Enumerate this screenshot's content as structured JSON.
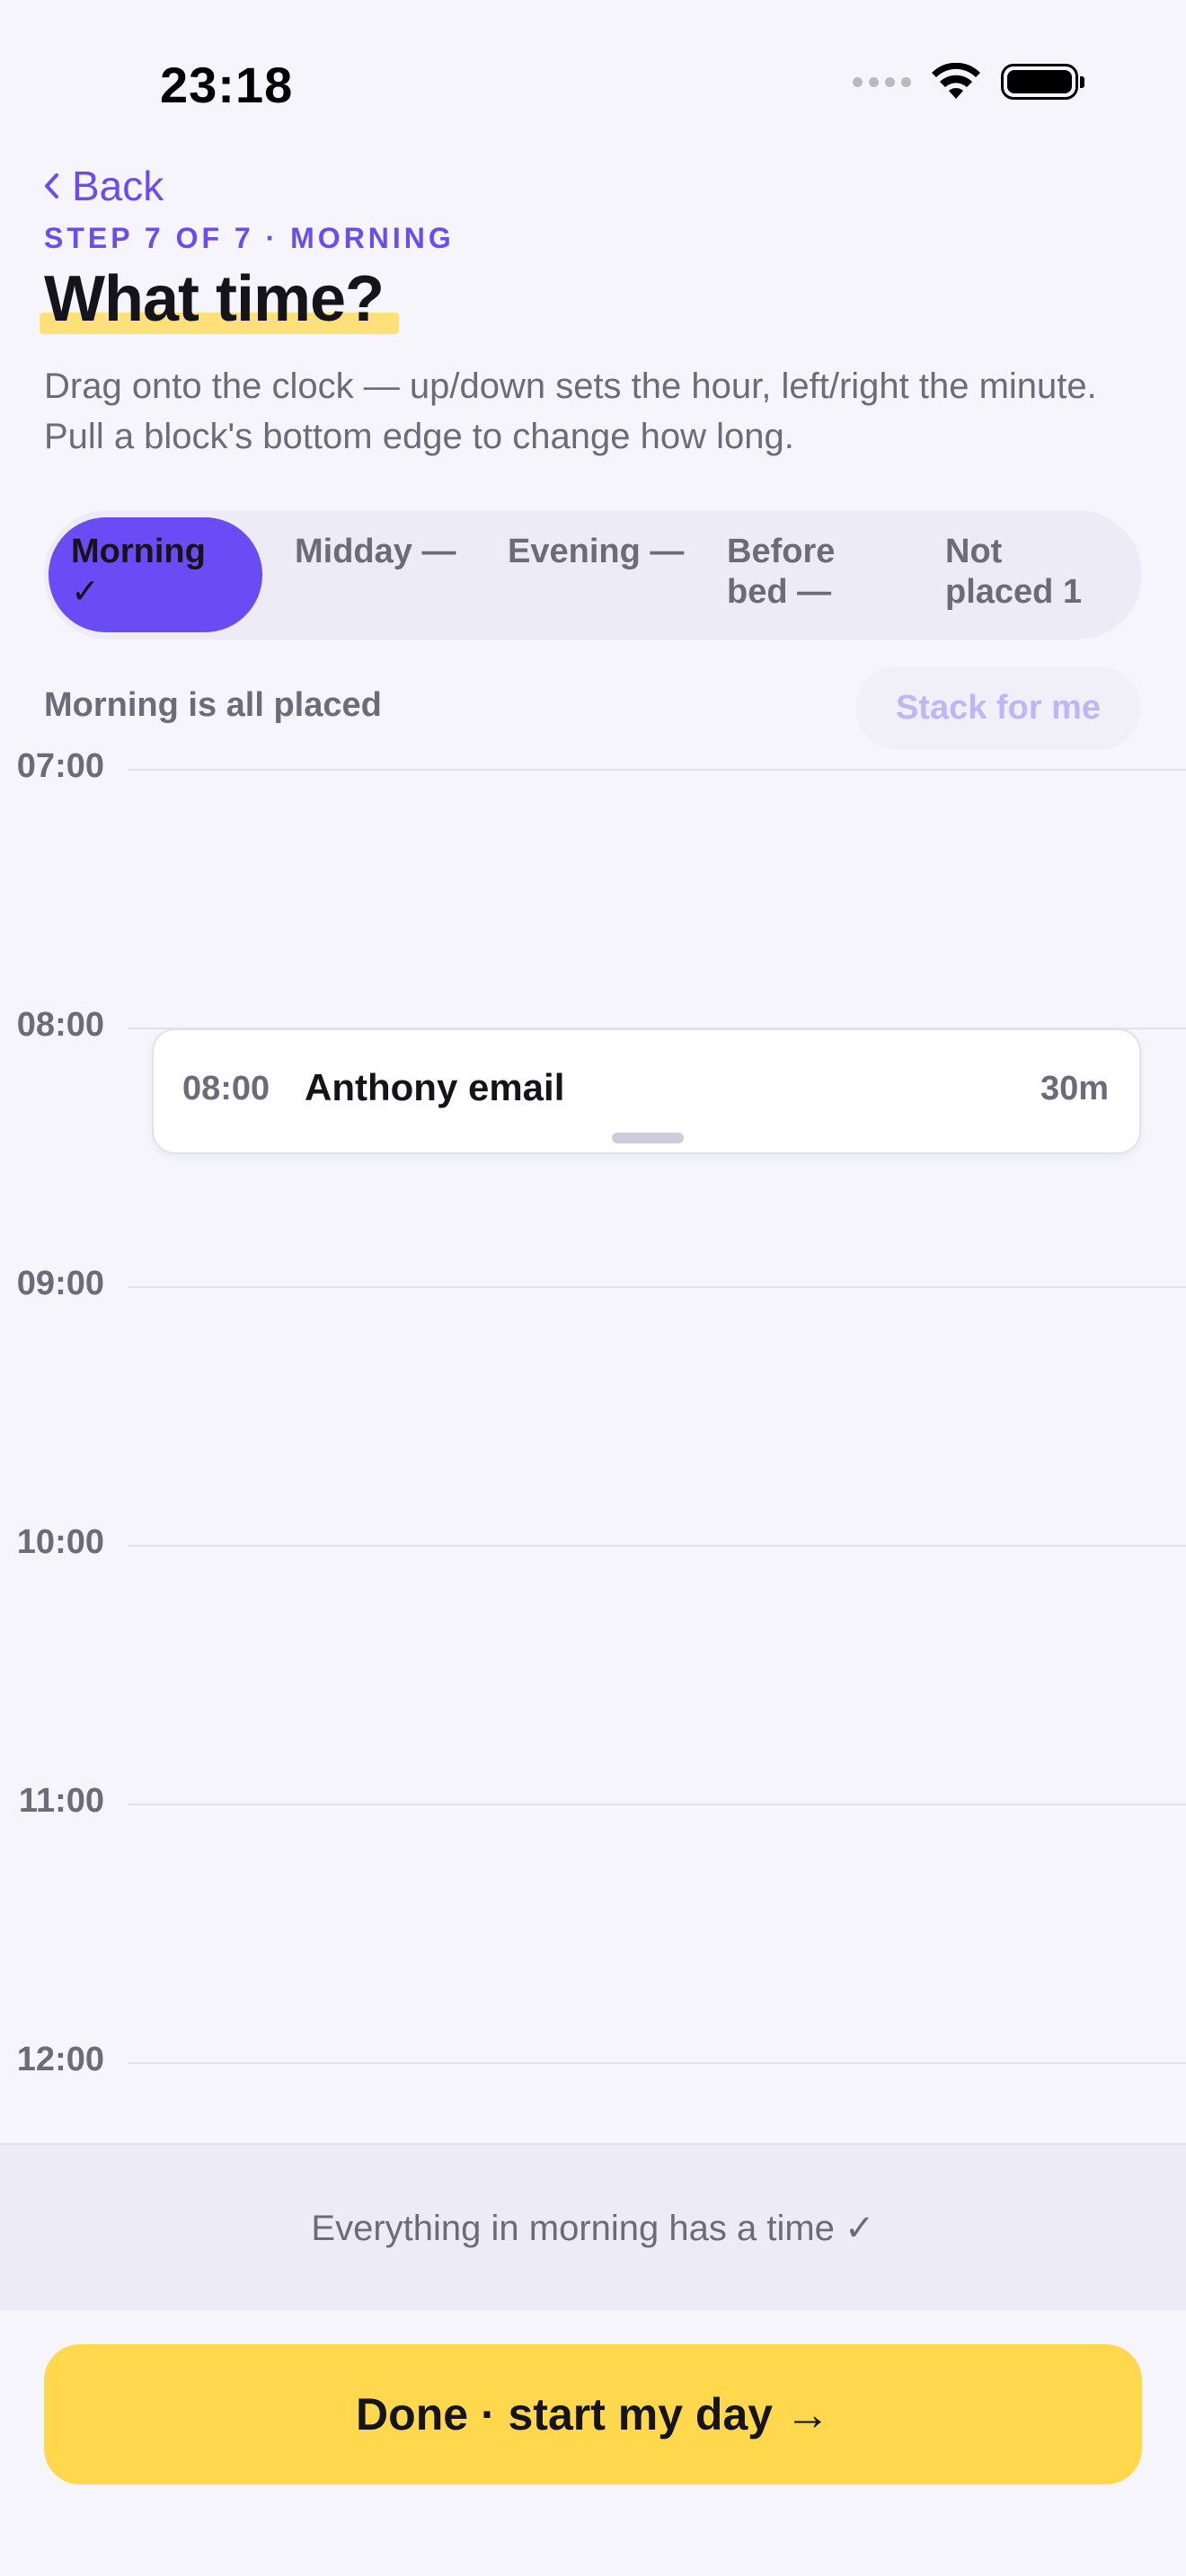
{
  "status_bar": {
    "time": "23:18"
  },
  "header": {
    "back_label": "Back",
    "step_label": "STEP 7 OF 7 · MORNING",
    "title": "What time?",
    "subtitle": "Drag onto the clock — up/down sets the hour, left/right the minute. Pull a block's bottom edge to change how long."
  },
  "segments": [
    {
      "line1": "Morning",
      "line2": "✓",
      "active": true
    },
    {
      "line1": "Midday —",
      "line2": "",
      "active": false
    },
    {
      "line1": "Evening —",
      "line2": "",
      "active": false
    },
    {
      "line1": "Before",
      "line2": "bed —",
      "active": false
    },
    {
      "line1": "Not",
      "line2": "placed 1",
      "active": false
    }
  ],
  "placement": {
    "status": "Morning is all placed",
    "stack_label": "Stack for me"
  },
  "timeline": {
    "hours": [
      "07:00",
      "08:00",
      "09:00",
      "10:00",
      "11:00",
      "12:00"
    ],
    "events": [
      {
        "time": "08:00",
        "title": "Anthony email",
        "duration": "30m"
      }
    ]
  },
  "footer": {
    "message": "Everything in morning has a time ✓",
    "done_label": "Done · start my day →"
  },
  "colors": {
    "accent": "#6a4df0",
    "active_segment": "#6a4cf5",
    "highlight": "#ffe07a",
    "primary_button": "#ffd84e",
    "background": "#f6f5fc"
  }
}
